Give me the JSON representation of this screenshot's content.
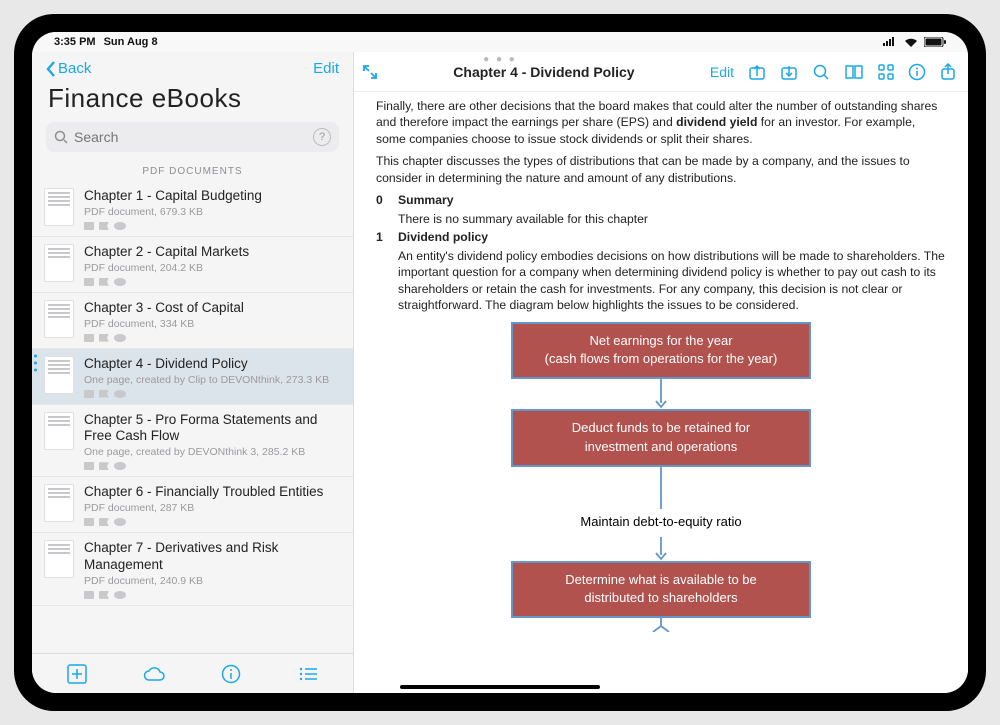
{
  "status": {
    "time": "3:35 PM",
    "date": "Sun Aug 8"
  },
  "sidebar": {
    "back": "Back",
    "edit": "Edit",
    "title": "Finance eBooks",
    "search_placeholder": "Search",
    "section": "PDF DOCUMENTS",
    "items": [
      {
        "title": "Chapter 1 - Capital Budgeting",
        "meta": "PDF document, 679.3 KB"
      },
      {
        "title": "Chapter 2 - Capital Markets",
        "meta": "PDF document, 204.2 KB"
      },
      {
        "title": "Chapter 3 - Cost of Capital",
        "meta": "PDF document, 334 KB"
      },
      {
        "title": "Chapter 4 - Dividend Policy",
        "meta": "One page, created by Clip to DEVONthink, 273.3 KB"
      },
      {
        "title": "Chapter 5 - Pro Forma Statements and Free Cash Flow",
        "meta": "One page, created by DEVONthink 3, 285.2 KB"
      },
      {
        "title": "Chapter 6 - Financially Troubled Entities",
        "meta": "PDF document, 287 KB"
      },
      {
        "title": "Chapter 7 - Derivatives and Risk Management",
        "meta": "PDF document, 240.9 KB"
      }
    ]
  },
  "content": {
    "title": "Chapter 4 - Dividend Policy",
    "edit": "Edit",
    "para1a": "Finally, there are other decisions that the board makes that could alter the number of outstanding shares and therefore impact the earnings per share (EPS) and ",
    "para1b": "dividend yield",
    "para1c": " for an investor. For example, some companies choose to issue stock dividends or split their shares.",
    "para2": "This chapter discusses the types of distributions that can be made by a company, and the issues to consider in determining the nature and amount of any distributions.",
    "sec0_num": "0",
    "sec0_title": "Summary",
    "sec0_text": "There is no summary available for this chapter",
    "sec1_num": "1",
    "sec1_title": "Dividend policy",
    "sec1_text": "An entity's dividend policy embodies decisions on how distributions will be made to shareholders. The important question for a company when determining dividend policy is whether to pay out cash to its shareholders or retain the cash for investments. For any company, this decision is not clear or straightforward. The diagram below highlights the issues to be considered.",
    "diagram": {
      "box1a": "Net earnings for the year",
      "box1b": "(cash flows from operations for the year)",
      "box2a": "Deduct funds to be retained for",
      "box2b": "investment and operations",
      "label": "Maintain debt-to-equity ratio",
      "box3a": "Determine what is available to be",
      "box3b": "distributed to shareholders"
    }
  }
}
